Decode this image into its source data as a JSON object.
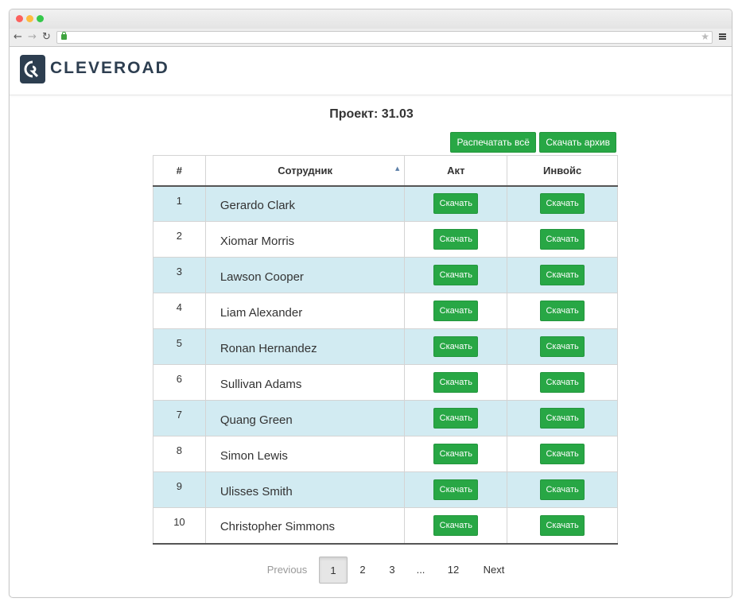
{
  "brand": {
    "name": "CLEVEROAD",
    "color": "#2d3e50"
  },
  "page": {
    "title": "Проект: 31.03"
  },
  "actions": {
    "print_all": "Распечатать всё",
    "download_archive": "Скачать архив"
  },
  "table": {
    "columns": [
      "#",
      "Сотрудник",
      "Акт",
      "Инвойс"
    ],
    "download_label": "Скачать",
    "rows": [
      {
        "num": "1",
        "name": "Gerardo Clark"
      },
      {
        "num": "2",
        "name": "Xiomar Morris"
      },
      {
        "num": "3",
        "name": "Lawson Cooper"
      },
      {
        "num": "4",
        "name": "Liam Alexander"
      },
      {
        "num": "5",
        "name": "Ronan Hernandez"
      },
      {
        "num": "6",
        "name": "Sullivan Adams"
      },
      {
        "num": "7",
        "name": "Quang Green"
      },
      {
        "num": "8",
        "name": "Simon Lewis"
      },
      {
        "num": "9",
        "name": "Ulisses Smith"
      },
      {
        "num": "10",
        "name": "Christopher Simmons"
      }
    ]
  },
  "pagination": {
    "previous": "Previous",
    "pages": [
      "1",
      "2",
      "3",
      "...",
      "12"
    ],
    "active_page": "1",
    "next": "Next"
  },
  "colors": {
    "accent_green": "#28a745",
    "row_stripe": "#d2ebf2"
  }
}
